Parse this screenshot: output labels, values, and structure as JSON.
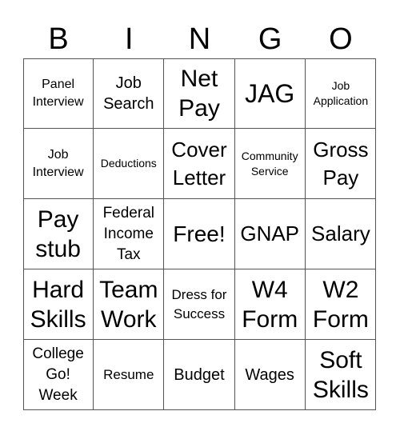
{
  "header": {
    "letters": [
      "B",
      "I",
      "N",
      "G",
      "O"
    ]
  },
  "grid": {
    "rows": [
      [
        {
          "text": "Panel Interview",
          "size": "s15"
        },
        {
          "text": "Job Search",
          "size": "s20"
        },
        {
          "text": "Net Pay",
          "size": "s30"
        },
        {
          "text": "JAG",
          "size": "s32"
        },
        {
          "text": "Job Application",
          "size": "s14"
        }
      ],
      [
        {
          "text": "Job Interview",
          "size": "s15"
        },
        {
          "text": "Deductions",
          "size": "s14"
        },
        {
          "text": "Cover Letter",
          "size": "s26"
        },
        {
          "text": "Community Service",
          "size": "s14"
        },
        {
          "text": "Gross Pay",
          "size": "s26"
        }
      ],
      [
        {
          "text": "Pay stub",
          "size": "s30"
        },
        {
          "text": "Federal Income Tax",
          "size": "s18"
        },
        {
          "text": "Free!",
          "size": "s28"
        },
        {
          "text": "GNAP",
          "size": "s26"
        },
        {
          "text": "Salary",
          "size": "s26"
        }
      ],
      [
        {
          "text": "Hard Skills",
          "size": "s30"
        },
        {
          "text": "Team Work",
          "size": "s30"
        },
        {
          "text": "Dress for Success",
          "size": "s16"
        },
        {
          "text": "W4 Form",
          "size": "s30"
        },
        {
          "text": "W2 Form",
          "size": "s30"
        }
      ],
      [
        {
          "text": "College Go! Week",
          "size": "s18"
        },
        {
          "text": "Resume",
          "size": "s16"
        },
        {
          "text": "Budget",
          "size": "s20"
        },
        {
          "text": "Wages",
          "size": "s20"
        },
        {
          "text": "Soft Skills",
          "size": "s30"
        }
      ]
    ]
  },
  "colors": {
    "border": "#555555",
    "text": "#000000",
    "background": "#ffffff"
  }
}
